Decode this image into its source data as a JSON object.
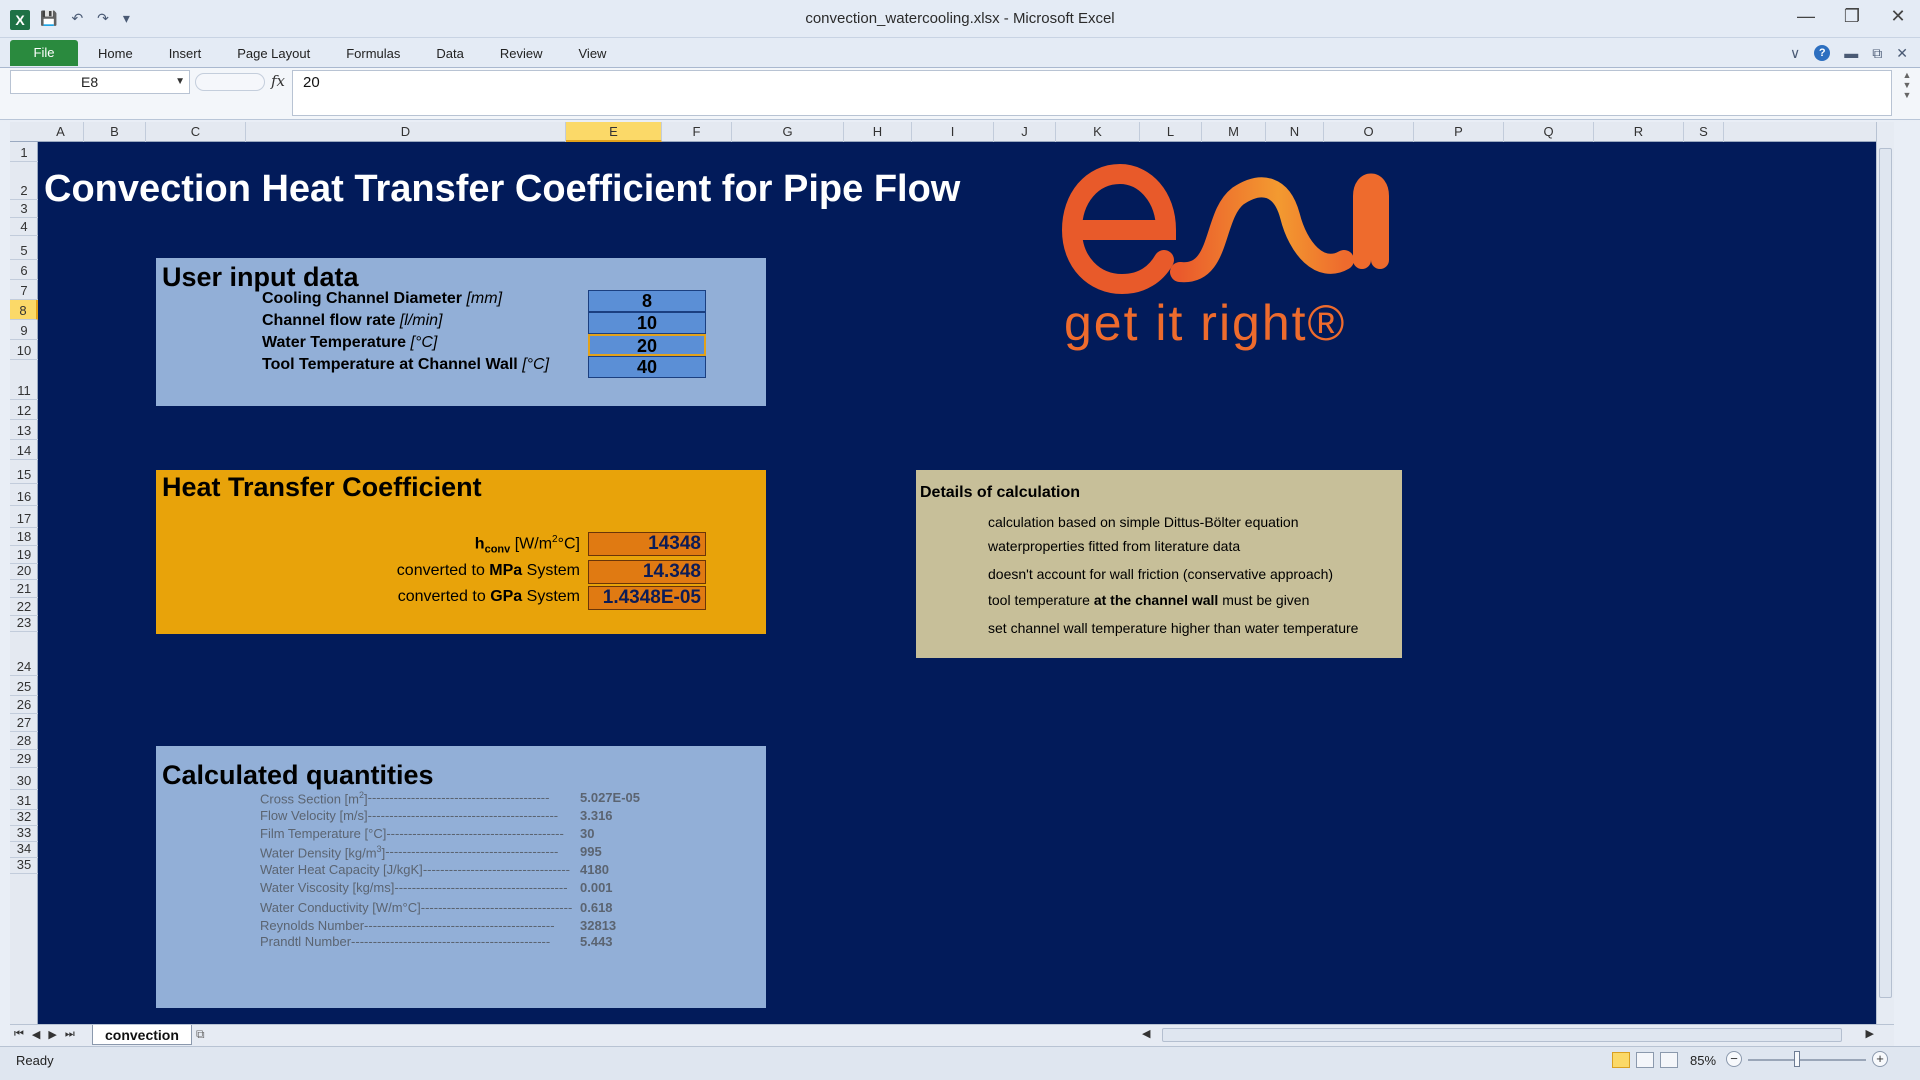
{
  "window": {
    "title": "convection_watercooling.xlsx  -  Microsoft Excel",
    "app_icon": "X"
  },
  "qat": {
    "save_icon": "floppy-icon",
    "undo_icon": "undo-icon",
    "redo_icon": "redo-icon"
  },
  "ribbon": {
    "file_label": "File",
    "tabs": [
      "Home",
      "Insert",
      "Page Layout",
      "Formulas",
      "Data",
      "Review",
      "View"
    ]
  },
  "formula_bar": {
    "name_box": "E8",
    "fx": "fx",
    "value": "20"
  },
  "columns": [
    "A",
    "B",
    "C",
    "D",
    "E",
    "F",
    "G",
    "H",
    "I",
    "J",
    "K",
    "L",
    "M",
    "N",
    "O",
    "P",
    "Q",
    "R",
    "S"
  ],
  "selected_column": "E",
  "rows": [
    "1",
    "2",
    "3",
    "4",
    "5",
    "6",
    "7",
    "8",
    "9",
    "10",
    "11",
    "12",
    "13",
    "14",
    "15",
    "16",
    "17",
    "18",
    "19",
    "20",
    "21",
    "22",
    "23",
    "24",
    "25",
    "26",
    "27",
    "28",
    "29",
    "30",
    "31",
    "32",
    "33",
    "34",
    "35"
  ],
  "selected_row": "8",
  "sheet": {
    "title": "Convection Heat Transfer Coefficient for Pipe Flow",
    "input": {
      "heading": "User input data",
      "rows": [
        {
          "label": "Cooling Channel Diameter",
          "unit": "[mm]",
          "value": "8"
        },
        {
          "label": "Channel flow rate",
          "unit": "[l/min]",
          "value": "10"
        },
        {
          "label": "Water Temperature",
          "unit": "[°C]",
          "value": "20"
        },
        {
          "label": "Tool Temperature at Channel Wall",
          "unit": "[°C]",
          "value": "40"
        }
      ]
    },
    "htc": {
      "heading": "Heat Transfer Coefficient",
      "h_symbol": "h",
      "h_sub": "conv",
      "h_unit_pre": " [W/m",
      "h_unit_sup": "2",
      "h_unit_post": "°C]",
      "h_value": "14348",
      "mpa_pre": "converted to ",
      "mpa_bold": "MPa",
      "mpa_post": " System",
      "mpa_value": "14.348",
      "gpa_pre": "converted to ",
      "gpa_bold": "GPa",
      "gpa_post": " System",
      "gpa_value": "1.4348E-05"
    },
    "calculated": {
      "heading": "Calculated quantities",
      "rows": [
        {
          "label": "Cross Section [m",
          "sup": "2",
          "label_end": "] ",
          "dashes": "------------------------------------------",
          "value": "5.027E-05"
        },
        {
          "label": "Flow Velocity [m/s] ",
          "sup": "",
          "label_end": "",
          "dashes": "--------------------------------------------",
          "value": "3.316"
        },
        {
          "label": "Film Temperature [°C] ",
          "sup": "",
          "label_end": "",
          "dashes": "-----------------------------------------",
          "value": "30"
        },
        {
          "label": "Water Density [kg/m",
          "sup": "3",
          "label_end": "] ",
          "dashes": "----------------------------------------",
          "value": "995"
        },
        {
          "label": "Water Heat Capacity [J/kgK] ",
          "sup": "",
          "label_end": "",
          "dashes": "----------------------------------",
          "value": "4180"
        },
        {
          "label": "Water Viscosity [kg/ms] ",
          "sup": "",
          "label_end": "",
          "dashes": "----------------------------------------",
          "value": "0.001"
        },
        {
          "label": "Water Conductivity [W/m°C] ",
          "sup": "",
          "label_end": "",
          "dashes": "-----------------------------------",
          "value": "0.618"
        },
        {
          "label": "Reynolds Number ",
          "sup": "",
          "label_end": "",
          "dashes": "--------------------------------------------",
          "value": "32813"
        },
        {
          "label": "Prandtl Number ",
          "sup": "",
          "label_end": "",
          "dashes": "----------------------------------------------",
          "value": "5.443"
        }
      ]
    },
    "details": {
      "title": "Details of calculation",
      "lines": [
        {
          "text": "calculation based on simple Dittus-Bölter equation",
          "bold": "",
          "after": ""
        },
        {
          "text": "waterproperties fitted from literature data",
          "bold": "",
          "after": ""
        },
        {
          "text": "doesn't account for wall friction (conservative approach)",
          "bold": "",
          "after": ""
        },
        {
          "text": "tool temperature ",
          "bold": "at the channel wall",
          "after": " must be given"
        },
        {
          "text": "set channel wall temperature higher than water temperature",
          "bold": "",
          "after": ""
        }
      ]
    },
    "logo": {
      "wordmark": "esi",
      "tagline": "get it right®",
      "color": "#ee6b2d",
      "gradient_end": "#f6a531"
    }
  },
  "sheet_tabs": {
    "active": "convection"
  },
  "status": {
    "ready": "Ready",
    "zoom": "85%"
  },
  "colors": {
    "sheet_bg": "#021b5a",
    "input_panel": "#92afd7",
    "input_cell": "#5b8fd6",
    "htc_panel": "#e8a30a",
    "htc_cell": "#e07a12",
    "details_panel": "#c7bf99",
    "selection": "#fbd968"
  }
}
